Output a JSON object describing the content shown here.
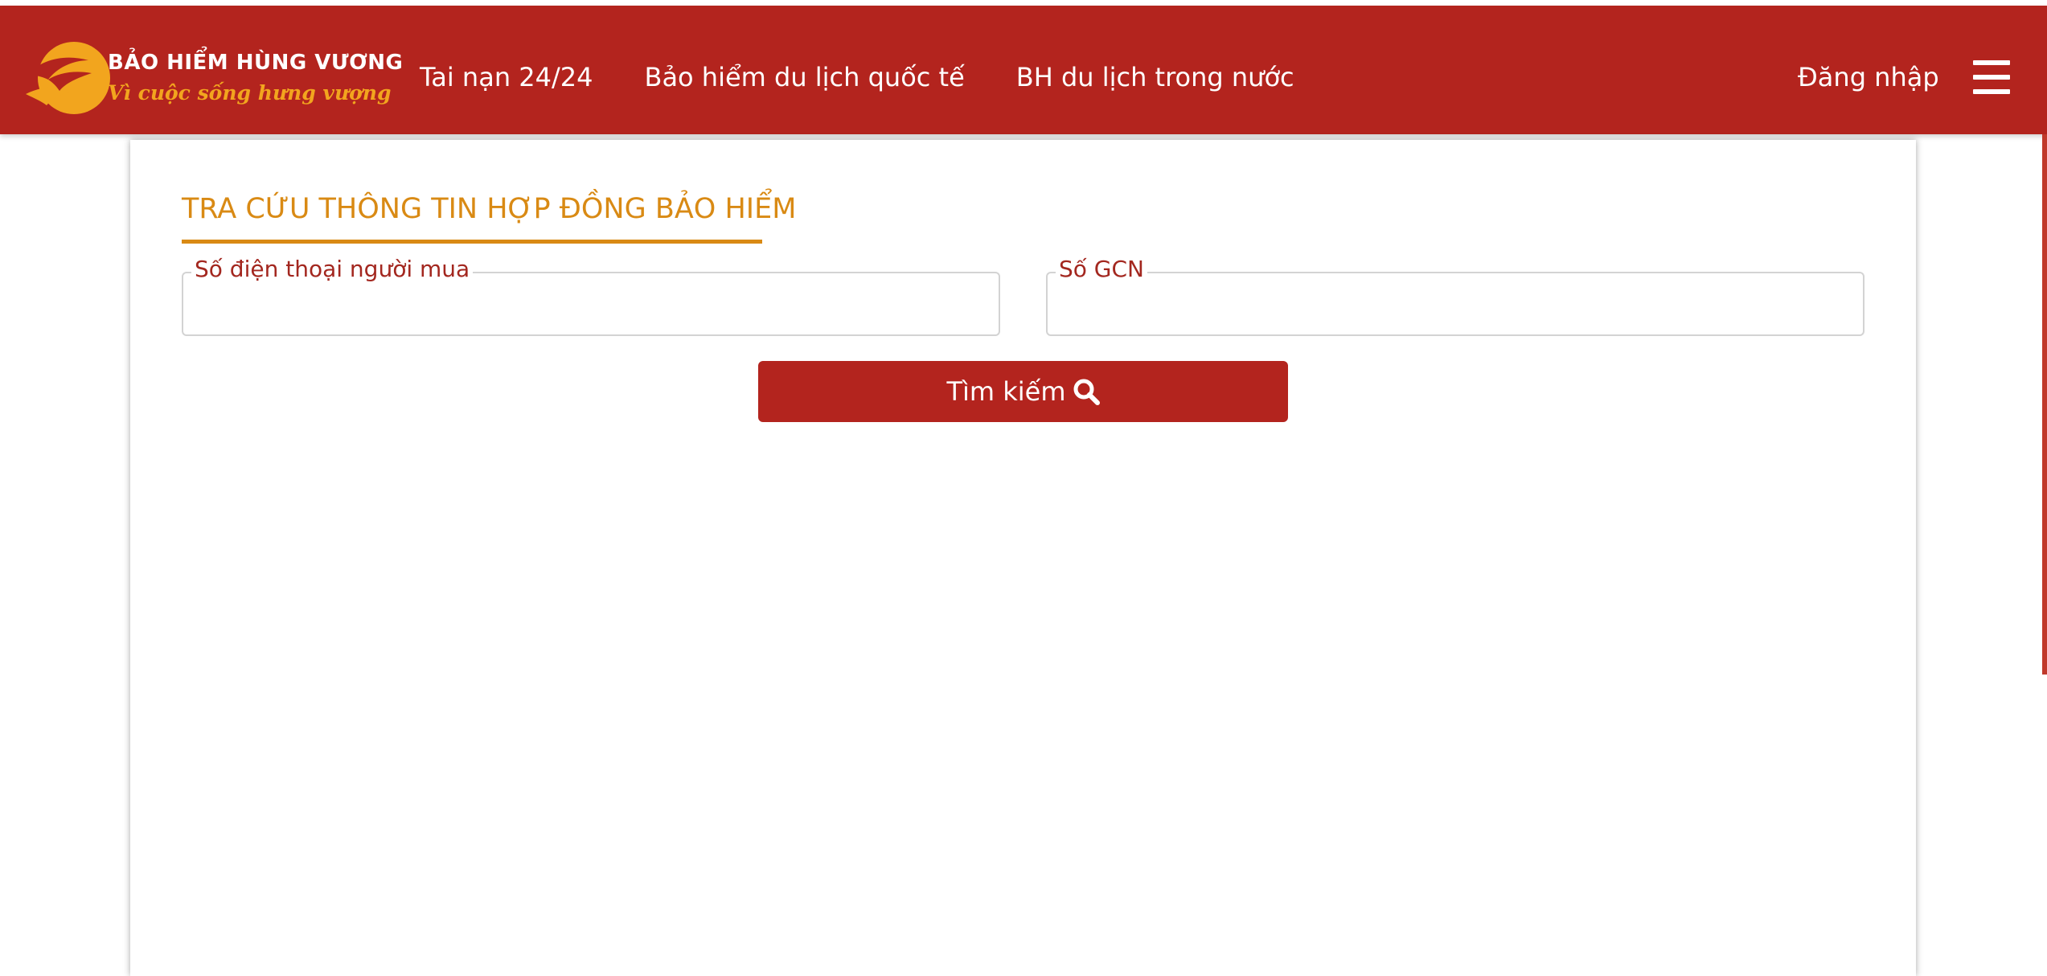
{
  "brand": {
    "title": "BẢO HIỂM HÙNG VƯƠNG",
    "slogan": "Vì cuộc sống hưng vượng",
    "colors": {
      "header": "#b3241e",
      "accent": "#d98a14",
      "logo_yellow": "#f2a51e"
    }
  },
  "nav": {
    "items": [
      {
        "label": "Tai nạn 24/24"
      },
      {
        "label": "Bảo hiểm du lịch quốc tế"
      },
      {
        "label": "BH du lịch trong nước"
      }
    ],
    "login_label": "Đăng nhập",
    "menu_icon": "hamburger-icon"
  },
  "lookup": {
    "title": "TRA CỨU THÔNG TIN HỢP ĐỒNG BẢO HIỂM",
    "phone_field": {
      "label": "Số điện thoại người mua",
      "value": "",
      "placeholder": ""
    },
    "gcn_field": {
      "label": "Số GCN",
      "value": "",
      "placeholder": ""
    },
    "search_button": {
      "label": "Tìm kiếm",
      "icon": "search-icon"
    }
  }
}
